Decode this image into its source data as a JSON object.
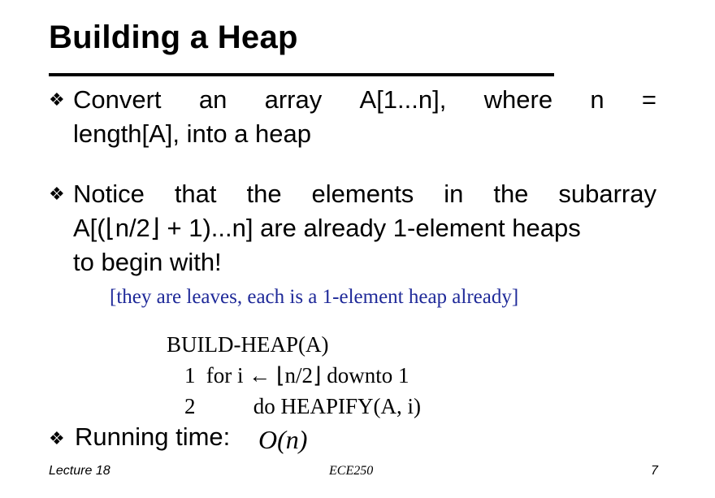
{
  "slide": {
    "title": "Building a Heap",
    "bullet1": {
      "line1_words": [
        "Convert",
        "an",
        "array",
        "A[1...n],",
        "where",
        "n",
        "="
      ],
      "line2": "length[A], into a heap"
    },
    "bullet2": {
      "line1_words": [
        "Notice",
        "that",
        "the",
        "elements",
        "in",
        "the",
        "subarray"
      ],
      "line2": "A[(⌊n/2⌋ + 1)...n] are already 1-element heaps",
      "line3": "to begin with!"
    },
    "note": "[they are leaves, each is a 1-element heap already]",
    "algorithm": {
      "header": "BUILD-HEAP(A)",
      "line1_num": "1",
      "line1_text": "for i ← ⌊n/2⌋ downto 1",
      "line2_num": "2",
      "line2_text": "do HEAPIFY(A, i)"
    },
    "running_time_label": "Running time:",
    "running_time_formula": "O(n)"
  },
  "footer": {
    "left": "Lecture 18",
    "center": "ECE250",
    "right": "7"
  },
  "icons": {
    "bullet": "four-diamond-bullet-icon"
  }
}
